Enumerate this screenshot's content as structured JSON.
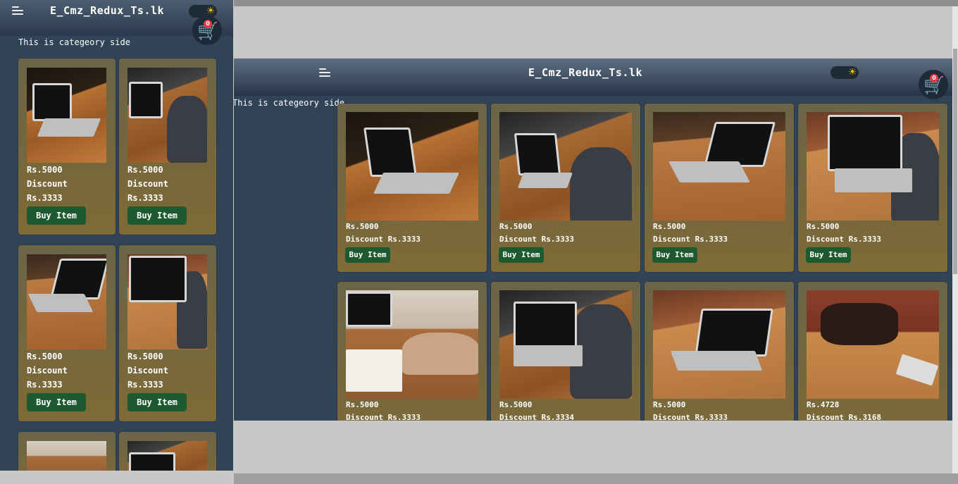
{
  "app": {
    "title": "E_Cmz_Redux_Ts.lk",
    "category_text": "This is categeory side",
    "cart_count": "0",
    "icons": {
      "menu": "menu-icon",
      "theme": "sun-icon",
      "cart": "cart-icon"
    }
  },
  "colors": {
    "header_top": "#5f6f82",
    "header_bottom": "#263547",
    "page_bg": "#314356",
    "card_bg": "#7e6a36",
    "button_bg": "#1e5a2f",
    "badge": "#e63946",
    "cart_icon": "#1d2ee0"
  },
  "big_view": {
    "products": [
      {
        "price": "Rs.5000",
        "discount": "Discount Rs.3333",
        "button": "Buy Item"
      },
      {
        "price": "Rs.5000",
        "discount": "Discount Rs.3333",
        "button": "Buy Item"
      },
      {
        "price": "Rs.5000",
        "discount": "Discount Rs.3333",
        "button": "Buy Item"
      },
      {
        "price": "Rs.5000",
        "discount": "Discount Rs.3333",
        "button": "Buy Item"
      },
      {
        "price": "Rs.5000",
        "discount": "Discount Rs.3333"
      },
      {
        "price": "Rs.5000",
        "discount": "Discount Rs.3334"
      },
      {
        "price": "Rs.5000",
        "discount": "Discount Rs.3333"
      },
      {
        "price": "Rs.4728",
        "discount": "Discount Rs.3168"
      }
    ]
  },
  "small_view": {
    "products": [
      {
        "price": "Rs.5000",
        "discount_label": "Discount",
        "discount": "Rs.3333",
        "button": "Buy Item"
      },
      {
        "price": "Rs.5000",
        "discount_label": "Discount",
        "discount": "Rs.3333",
        "button": "Buy Item"
      },
      {
        "price": "Rs.5000",
        "discount_label": "Discount",
        "discount": "Rs.3333",
        "button": "Buy Item"
      },
      {
        "price": "Rs.5000",
        "discount_label": "Discount",
        "discount": "Rs.3333",
        "button": "Buy Item"
      }
    ]
  }
}
